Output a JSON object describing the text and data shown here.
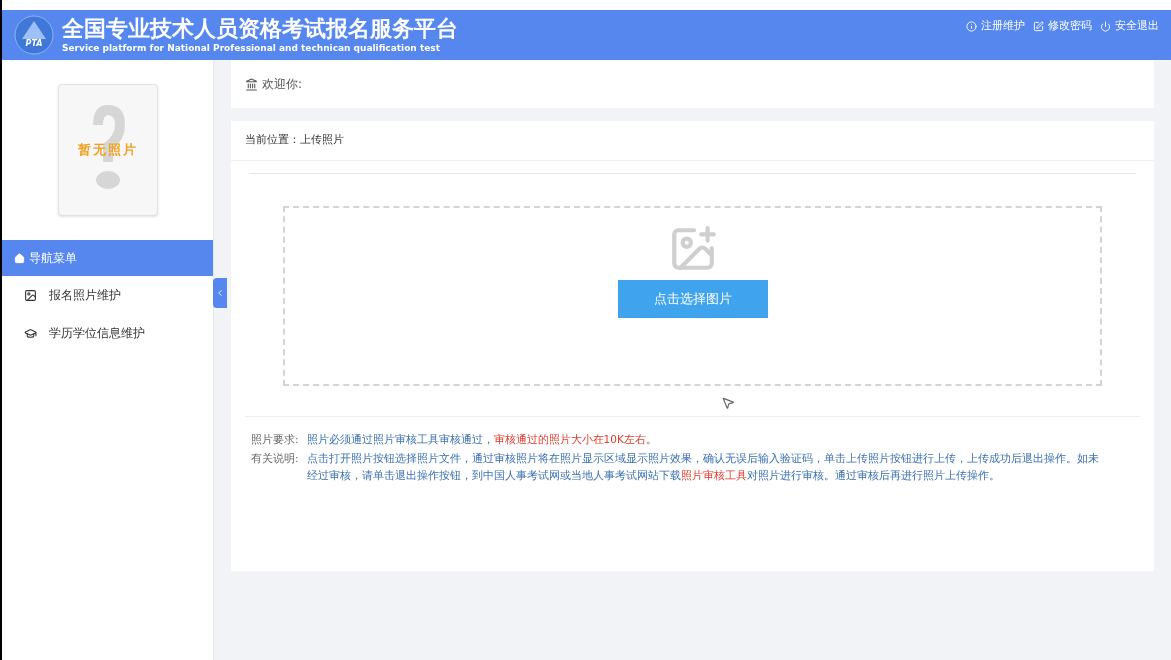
{
  "header": {
    "title": "全国专业技术人员资格考试报名服务平台",
    "subtitle": "Service platform for National Professional and technican qualification test",
    "logo_text": "PTA",
    "links": [
      {
        "kind": "info",
        "label": "注册维护"
      },
      {
        "kind": "edit",
        "label": "修改密码"
      },
      {
        "kind": "power",
        "label": "安全退出"
      }
    ]
  },
  "sidebar": {
    "photo_placeholder": "暂无照片",
    "menu_title": "导航菜单",
    "items": [
      {
        "kind": "image",
        "label": "报名照片维护"
      },
      {
        "kind": "cap",
        "label": "学历学位信息维护"
      }
    ]
  },
  "welcome": {
    "label": "欢迎你:"
  },
  "breadcrumb": "当前位置：上传照片",
  "upload": {
    "button": "点击选择图片"
  },
  "notes": [
    {
      "label": "照片要求:",
      "segments": [
        {
          "text": "照片必须通过照片审核工具审核通过，",
          "highlight": false
        },
        {
          "text": "审核通过的照片大小在10K左右。",
          "highlight": true
        }
      ]
    },
    {
      "label": "有关说明:",
      "segments": [
        {
          "text": "点击打开照片按钮选择照片文件，通过审核照片将在照片显示区域显示照片效果，确认无误后输入验证码，单击上传照片按钮进行上传，上传成功后退出操作。如未经过审核，请单击退出操作按钮，到中国人事考试网或当地人事考试网站下载",
          "highlight": false
        },
        {
          "text": "照片审核工具",
          "highlight": true
        },
        {
          "text": "对照片进行审核。通过审核后再进行照片上传操作。",
          "highlight": false
        }
      ]
    }
  ]
}
